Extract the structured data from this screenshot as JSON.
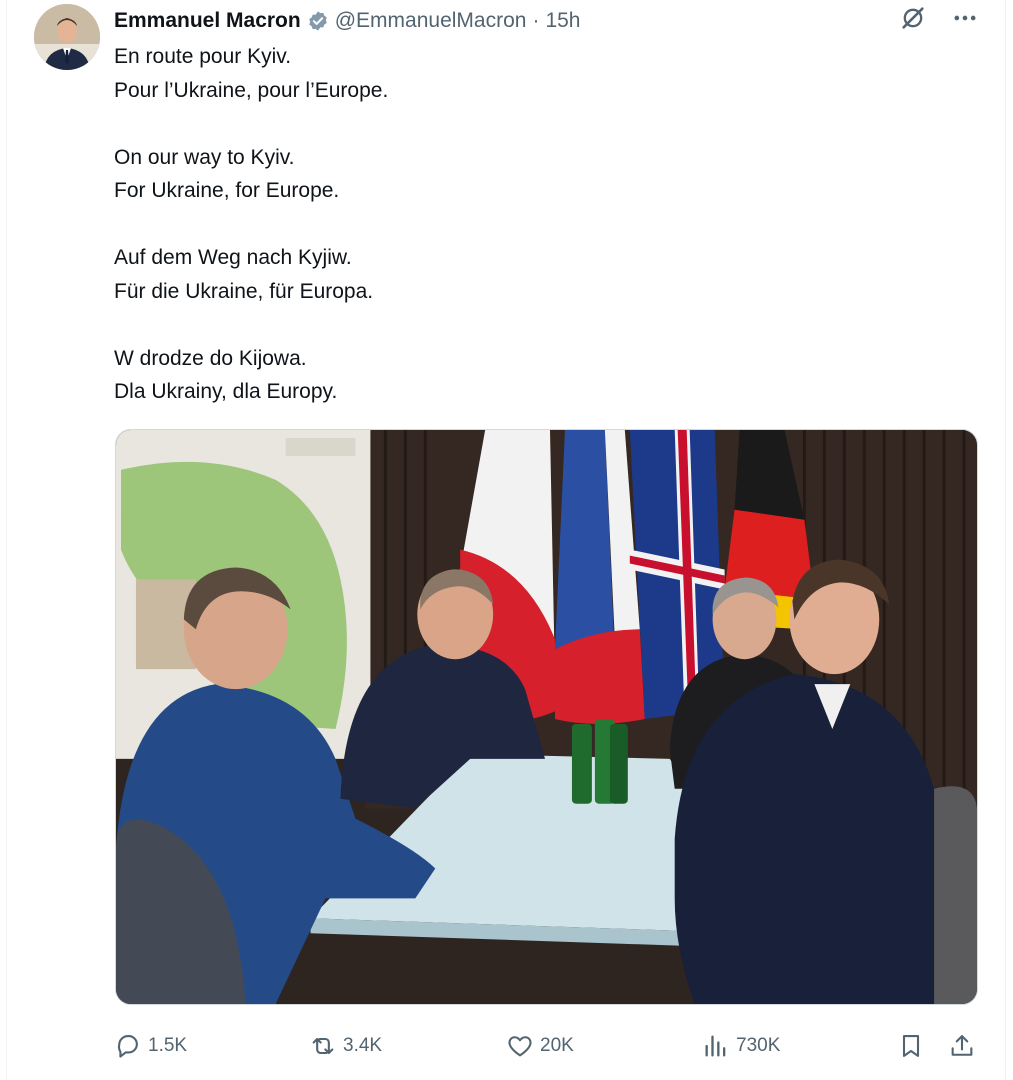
{
  "tweet": {
    "author_name": "Emmanuel Macron",
    "handle": "@EmmanuelMacron",
    "separator": "·",
    "time": "15h",
    "lines": [
      "En route pour Kyiv.",
      "Pour l’Ukraine, pour l’Europe.",
      "",
      "On our way to Kyiv.",
      "For Ukraine, for Europe.",
      "",
      "Auf dem Weg nach Kyjiw.",
      "Für die Ukraine, für Europa.",
      "",
      "W drodze do Kijowa.",
      "Dla Ukrainy, dla Europy."
    ],
    "image_alt": "photo",
    "icons": {
      "verified": "verified-badge-icon",
      "grok": "grok-icon",
      "more": "more-icon"
    }
  },
  "actions": {
    "replies": "1.5K",
    "reposts": "3.4K",
    "likes": "20K",
    "views": "730K"
  },
  "colors": {
    "text": "#0f1419",
    "muted": "#536471",
    "verified": "#829aab",
    "border": "#eff3f4"
  }
}
